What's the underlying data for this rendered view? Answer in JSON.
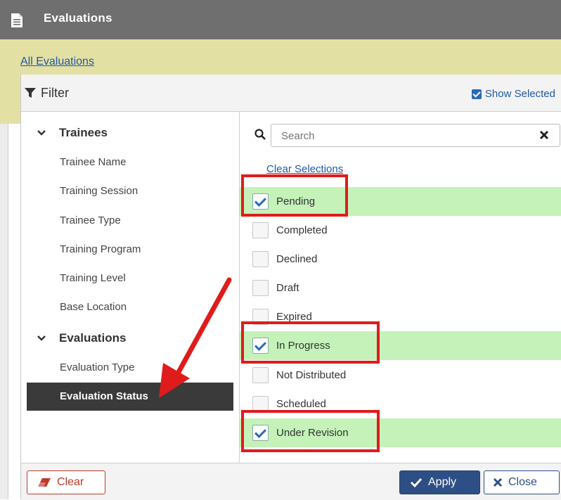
{
  "header": {
    "title": "Evaluations",
    "icon": "document-icon"
  },
  "breadcrumb": {
    "all_evaluations": "All Evaluations"
  },
  "filter": {
    "title": "Filter",
    "show_selected": "Show Selected",
    "show_selected_checked": true
  },
  "sidebar": {
    "groups": [
      {
        "label": "Trainees",
        "items": [
          "Trainee Name",
          "Training Session",
          "Trainee Type",
          "Training Program",
          "Training Level",
          "Base Location"
        ]
      },
      {
        "label": "Evaluations",
        "items": [
          "Evaluation Type",
          "Evaluation Status"
        ]
      }
    ],
    "active_item": "Evaluation Status"
  },
  "search": {
    "placeholder": "Search",
    "value": ""
  },
  "clear_selections": "Clear Selections",
  "statuses": [
    {
      "label": "Pending",
      "checked": true
    },
    {
      "label": "Completed",
      "checked": false
    },
    {
      "label": "Declined",
      "checked": false
    },
    {
      "label": "Draft",
      "checked": false
    },
    {
      "label": "Expired",
      "checked": false
    },
    {
      "label": "In Progress",
      "checked": true
    },
    {
      "label": "Not Distributed",
      "checked": false
    },
    {
      "label": "Scheduled",
      "checked": false
    },
    {
      "label": "Under Revision",
      "checked": true
    }
  ],
  "footer": {
    "clear": "Clear",
    "apply": "Apply",
    "close": "Close"
  },
  "colors": {
    "header": "#6f6f6f",
    "band": "#e3e0a4",
    "selected_row": "#c4f2b9",
    "highlight": "#e01b1b",
    "primary": "#2d4f85"
  }
}
